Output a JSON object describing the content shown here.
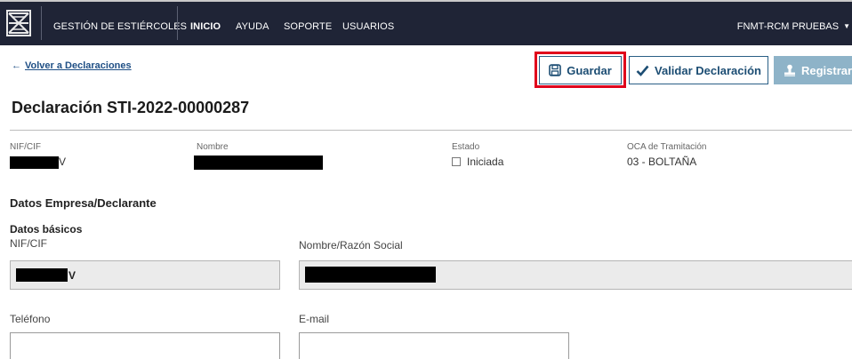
{
  "navbar": {
    "app_name": "GESTIÓN DE ESTIÉRCOLES",
    "items": [
      {
        "label": "INICIO",
        "active": true
      },
      {
        "label": "AYUDA",
        "active": false
      },
      {
        "label": "SOPORTE",
        "active": false
      },
      {
        "label": "USUARIOS",
        "active": false
      }
    ],
    "user": "FNMT-RCM PRUEBAS",
    "user_caret_icon": "caret-down-icon"
  },
  "back_link": {
    "arrow_icon": "arrow-left-icon",
    "label": "Volver a Declaraciones"
  },
  "actions": {
    "save": {
      "icon": "save-icon",
      "label": "Guardar"
    },
    "validate": {
      "icon": "check-icon",
      "label": "Validar Declaración"
    },
    "register": {
      "icon": "stamp-icon",
      "label": "Registrar"
    },
    "highlight_color": "#e0001b"
  },
  "page_title": "Declaración STI-2022-00000287",
  "summary": {
    "nif": {
      "label": "NIF/CIF",
      "visible_suffix": "V"
    },
    "nombre": {
      "label": "Nombre"
    },
    "estado": {
      "label": "Estado",
      "value": "Iniciada"
    },
    "oca": {
      "label": "OCA de Tramitación",
      "value": "03 - BOLTAÑA"
    }
  },
  "section": {
    "title": "Datos Empresa/Declarante",
    "subtitle": "Datos básicos",
    "fields": {
      "nif": {
        "label": "NIF/CIF",
        "visible_suffix": "V"
      },
      "razon_social": {
        "label": "Nombre/Razón Social"
      },
      "telefono": {
        "label": "Teléfono",
        "value": ""
      },
      "email": {
        "label": "E-mail",
        "value": ""
      }
    }
  },
  "colors": {
    "navbar": "#1f2436",
    "primary": "#1c4d73",
    "register_disabled": "#8eb3c8"
  }
}
